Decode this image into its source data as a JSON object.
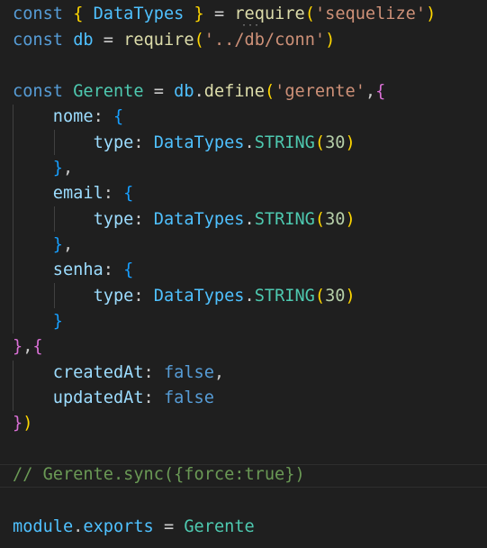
{
  "editor": {
    "theme": {
      "background": "#1f1f1f",
      "keyword": "#569cd6",
      "variable": "#4fc1ff",
      "class": "#4ec9b0",
      "function": "#dcdcaa",
      "string": "#ce9178",
      "property": "#9cdcfe",
      "number": "#b5cea8",
      "comment": "#6a9955",
      "bracket_level_1": "#ffd700",
      "bracket_level_2": "#da70d6",
      "bracket_level_3": "#179fff"
    },
    "tokens": {
      "const": "const",
      "datatypes": "DataTypes",
      "require": "require",
      "sequelize_str": "'sequelize'",
      "db": "db",
      "conn_str": "'../db/conn'",
      "gerente": "Gerente",
      "define": "define",
      "gerente_str": "'gerente'",
      "nome": "nome",
      "email": "email",
      "senha": "senha",
      "type": "type",
      "string_type": "STRING",
      "length": "30",
      "createdAt": "createdAt",
      "updatedAt": "updatedAt",
      "false": "false",
      "comment": "// Gerente.sync({force:true})",
      "module": "module",
      "exports": "exports"
    }
  }
}
